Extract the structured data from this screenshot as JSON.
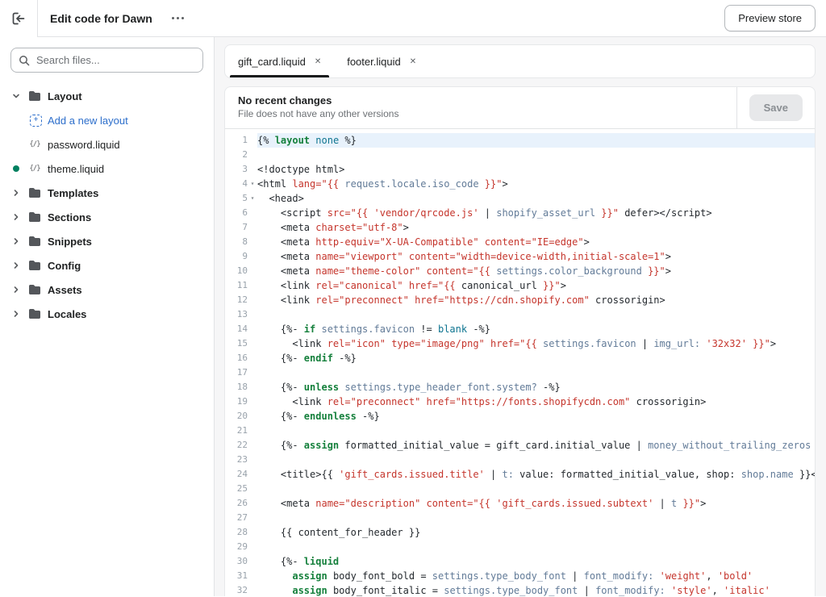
{
  "header": {
    "title": "Edit code for Dawn",
    "preview_button": "Preview store"
  },
  "icons": {
    "close_tab": "✕",
    "fold": "▾",
    "add_plus": "+"
  },
  "sidebar": {
    "search_placeholder": "Search files...",
    "file_icon_glyph": "{/}",
    "items": [
      {
        "type": "folder",
        "label": "Layout",
        "expanded": true
      },
      {
        "type": "action",
        "label": "Add a new layout"
      },
      {
        "type": "file",
        "label": "password.liquid"
      },
      {
        "type": "file",
        "label": "theme.liquid",
        "status_dot": true
      },
      {
        "type": "folder",
        "label": "Templates",
        "expanded": false
      },
      {
        "type": "folder",
        "label": "Sections",
        "expanded": false
      },
      {
        "type": "folder",
        "label": "Snippets",
        "expanded": false
      },
      {
        "type": "folder",
        "label": "Config",
        "expanded": false
      },
      {
        "type": "folder",
        "label": "Assets",
        "expanded": false
      },
      {
        "type": "folder",
        "label": "Locales",
        "expanded": false
      }
    ]
  },
  "tabs": [
    {
      "label": "gift_card.liquid",
      "active": true
    },
    {
      "label": "footer.liquid",
      "active": false
    }
  ],
  "info_bar": {
    "title": "No recent changes",
    "subtitle": "File does not have any other versions",
    "save_label": "Save"
  },
  "editor": {
    "lines": [
      {
        "n": 1,
        "active": true,
        "t": [
          [
            "p",
            "{% "
          ],
          [
            "k",
            "layout"
          ],
          [
            "p",
            " "
          ],
          [
            "a",
            "none"
          ],
          [
            "p",
            " %}"
          ]
        ]
      },
      {
        "n": 2,
        "t": []
      },
      {
        "n": 3,
        "t": [
          [
            "p",
            "<!doctype html>"
          ]
        ]
      },
      {
        "n": 4,
        "fold": true,
        "t": [
          [
            "p",
            "<html "
          ],
          [
            "s",
            "lang=\"{{ "
          ],
          [
            "v",
            "request.locale.iso_code"
          ],
          [
            "s",
            " }}\""
          ],
          [
            "p",
            ">"
          ]
        ]
      },
      {
        "n": 5,
        "fold": true,
        "t": [
          [
            "p",
            "  <head>"
          ]
        ]
      },
      {
        "n": 6,
        "t": [
          [
            "p",
            "    <script "
          ],
          [
            "s",
            "src=\"{{ "
          ],
          [
            "s",
            "'vendor/qrcode.js'"
          ],
          [
            "p",
            " | "
          ],
          [
            "v",
            "shopify_asset_url"
          ],
          [
            "s",
            " }}\""
          ],
          [
            "p",
            " defer></script>"
          ]
        ]
      },
      {
        "n": 7,
        "t": [
          [
            "p",
            "    <meta "
          ],
          [
            "s",
            "charset=\"utf-8\""
          ],
          [
            "p",
            ">"
          ]
        ]
      },
      {
        "n": 8,
        "t": [
          [
            "p",
            "    <meta "
          ],
          [
            "s",
            "http-equiv=\"X-UA-Compatible\""
          ],
          [
            "p",
            " "
          ],
          [
            "s",
            "content=\"IE=edge\""
          ],
          [
            "p",
            ">"
          ]
        ]
      },
      {
        "n": 9,
        "t": [
          [
            "p",
            "    <meta "
          ],
          [
            "s",
            "name=\"viewport\""
          ],
          [
            "p",
            " "
          ],
          [
            "s",
            "content=\"width=device-width,initial-scale=1\""
          ],
          [
            "p",
            ">"
          ]
        ]
      },
      {
        "n": 10,
        "t": [
          [
            "p",
            "    <meta "
          ],
          [
            "s",
            "name=\"theme-color\""
          ],
          [
            "p",
            " "
          ],
          [
            "s",
            "content=\"{{ "
          ],
          [
            "v",
            "settings.color_background"
          ],
          [
            "s",
            " }}\""
          ],
          [
            "p",
            ">"
          ]
        ]
      },
      {
        "n": 11,
        "t": [
          [
            "p",
            "    <link "
          ],
          [
            "s",
            "rel=\"canonical\""
          ],
          [
            "p",
            " "
          ],
          [
            "s",
            "href=\"{{ "
          ],
          [
            "p",
            "canonical_url"
          ],
          [
            "s",
            " }}\""
          ],
          [
            "p",
            ">"
          ]
        ]
      },
      {
        "n": 12,
        "t": [
          [
            "p",
            "    <link "
          ],
          [
            "s",
            "rel=\"preconnect\""
          ],
          [
            "p",
            " "
          ],
          [
            "s",
            "href=\"https://cdn.shopify.com\""
          ],
          [
            "p",
            " crossorigin>"
          ]
        ]
      },
      {
        "n": 13,
        "t": []
      },
      {
        "n": 14,
        "t": [
          [
            "p",
            "    {%- "
          ],
          [
            "k",
            "if"
          ],
          [
            "p",
            " "
          ],
          [
            "v",
            "settings.favicon"
          ],
          [
            "p",
            " != "
          ],
          [
            "a",
            "blank"
          ],
          [
            "p",
            " -%}"
          ]
        ]
      },
      {
        "n": 15,
        "t": [
          [
            "p",
            "      <link "
          ],
          [
            "s",
            "rel=\"icon\""
          ],
          [
            "p",
            " "
          ],
          [
            "s",
            "type=\"image/png\""
          ],
          [
            "p",
            " "
          ],
          [
            "s",
            "href=\"{{ "
          ],
          [
            "v",
            "settings.favicon"
          ],
          [
            "p",
            " | "
          ],
          [
            "v",
            "img_url:"
          ],
          [
            "p",
            " "
          ],
          [
            "s",
            "'32x32'"
          ],
          [
            "s",
            " }}\""
          ],
          [
            "p",
            ">"
          ]
        ]
      },
      {
        "n": 16,
        "t": [
          [
            "p",
            "    {%- "
          ],
          [
            "k",
            "endif"
          ],
          [
            "p",
            " -%}"
          ]
        ]
      },
      {
        "n": 17,
        "t": []
      },
      {
        "n": 18,
        "t": [
          [
            "p",
            "    {%- "
          ],
          [
            "k",
            "unless"
          ],
          [
            "p",
            " "
          ],
          [
            "v",
            "settings.type_header_font.system?"
          ],
          [
            "p",
            " -%}"
          ]
        ]
      },
      {
        "n": 19,
        "t": [
          [
            "p",
            "      <link "
          ],
          [
            "s",
            "rel=\"preconnect\""
          ],
          [
            "p",
            " "
          ],
          [
            "s",
            "href=\"https://fonts.shopifycdn.com\""
          ],
          [
            "p",
            " crossorigin>"
          ]
        ]
      },
      {
        "n": 20,
        "t": [
          [
            "p",
            "    {%- "
          ],
          [
            "k",
            "endunless"
          ],
          [
            "p",
            " -%}"
          ]
        ]
      },
      {
        "n": 21,
        "t": []
      },
      {
        "n": 22,
        "t": [
          [
            "p",
            "    {%- "
          ],
          [
            "k",
            "assign"
          ],
          [
            "p",
            " formatted_initial_value = gift_card.initial_value | "
          ],
          [
            "v",
            "money_without_trailing_zeros"
          ],
          [
            "p",
            " -%}"
          ]
        ]
      },
      {
        "n": 23,
        "t": []
      },
      {
        "n": 24,
        "t": [
          [
            "p",
            "    <title>{{ "
          ],
          [
            "s",
            "'gift_cards.issued.title'"
          ],
          [
            "p",
            " | "
          ],
          [
            "v",
            "t:"
          ],
          [
            "p",
            " value: formatted_initial_value, shop: "
          ],
          [
            "v",
            "shop.name"
          ],
          [
            "p",
            " }}</title>"
          ]
        ]
      },
      {
        "n": 25,
        "t": []
      },
      {
        "n": 26,
        "t": [
          [
            "p",
            "    <meta "
          ],
          [
            "s",
            "name=\"description\""
          ],
          [
            "p",
            " "
          ],
          [
            "s",
            "content=\"{{ "
          ],
          [
            "s",
            "'gift_cards.issued.subtext'"
          ],
          [
            "p",
            " | "
          ],
          [
            "v",
            "t"
          ],
          [
            "s",
            " }}\""
          ],
          [
            "p",
            ">"
          ]
        ]
      },
      {
        "n": 27,
        "t": []
      },
      {
        "n": 28,
        "t": [
          [
            "p",
            "    {{ content_for_header }}"
          ]
        ]
      },
      {
        "n": 29,
        "t": []
      },
      {
        "n": 30,
        "t": [
          [
            "p",
            "    {%- "
          ],
          [
            "k",
            "liquid"
          ]
        ]
      },
      {
        "n": 31,
        "t": [
          [
            "p",
            "      "
          ],
          [
            "k",
            "assign"
          ],
          [
            "p",
            " body_font_bold = "
          ],
          [
            "v",
            "settings.type_body_font"
          ],
          [
            "p",
            " | "
          ],
          [
            "v",
            "font_modify:"
          ],
          [
            "p",
            " "
          ],
          [
            "s",
            "'weight'"
          ],
          [
            "p",
            ", "
          ],
          [
            "s",
            "'bold'"
          ]
        ]
      },
      {
        "n": 32,
        "t": [
          [
            "p",
            "      "
          ],
          [
            "k",
            "assign"
          ],
          [
            "p",
            " body_font_italic = "
          ],
          [
            "v",
            "settings.type_body_font"
          ],
          [
            "p",
            " | "
          ],
          [
            "v",
            "font_modify:"
          ],
          [
            "p",
            " "
          ],
          [
            "s",
            "'style'"
          ],
          [
            "p",
            ", "
          ],
          [
            "s",
            "'italic'"
          ]
        ]
      }
    ]
  }
}
